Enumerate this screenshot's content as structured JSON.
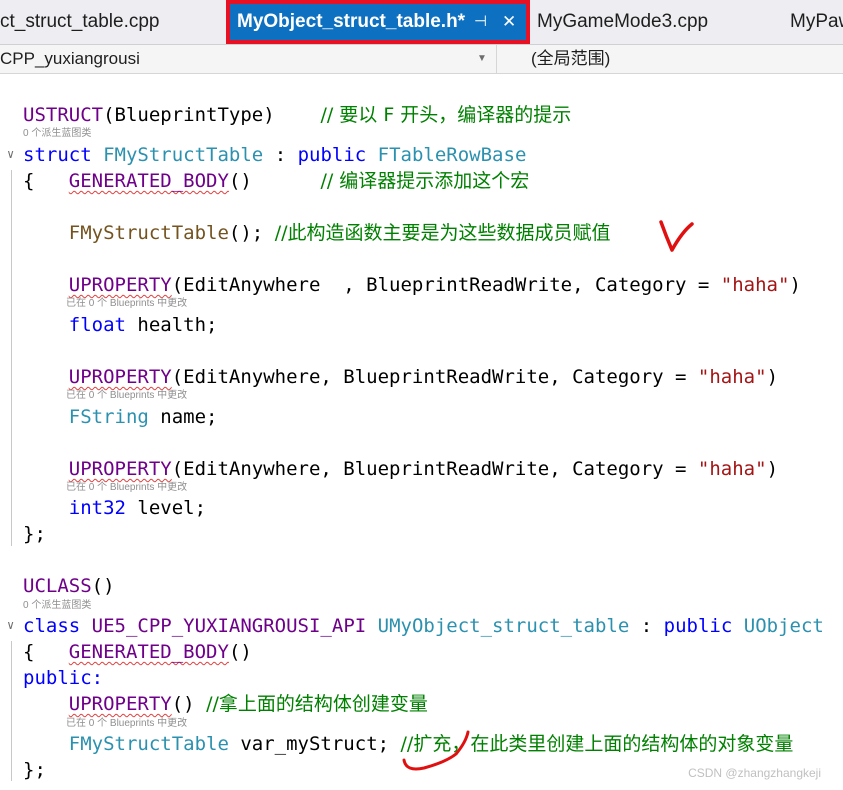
{
  "tabs": [
    {
      "label": "ct_struct_table.cpp"
    },
    {
      "label": "MyObject_struct_table.h*",
      "pin": "⊣",
      "close": "✕"
    },
    {
      "label": "MyGameMode3.cpp"
    },
    {
      "label": "MyPaw"
    }
  ],
  "nav": {
    "project": "CPP_yuxiangrousi",
    "scope": "(全局范围)"
  },
  "code": {
    "l1_macro": "USTRUCT",
    "l1_args": "(BlueprintType)",
    "l1_comment": "// 要以 F 开头，编译器的提示",
    "cl1": "0 个派生蓝图类",
    "l2_kw": "struct",
    "l2_name": "FMyStructTable",
    "l2_colon": " : ",
    "l2_public": "public",
    "l2_base": "FTableRowBase",
    "l3_brace": "{",
    "l3_macro": "GENERATED_BODY",
    "l3_parens": "()",
    "l3_comment": "// 编译器提示添加这个宏",
    "l4_ctor": "FMyStructTable",
    "l4_rest": "();",
    "l4_comment": "//此构造函数主要是为这些数据成员赋值",
    "l5_macro": "UPROPERTY",
    "l5_args": "(EditAnywhere  , BlueprintReadWrite, Category = ",
    "l5_str": "\"haha\"",
    "l5_close": ")",
    "cl5": "已在 0 个 Blueprints 中更改",
    "l6_type": "float",
    "l6_rest": " health;",
    "l7_macro": "UPROPERTY",
    "l7_args": "(EditAnywhere, BlueprintReadWrite, Category = ",
    "l7_str": "\"haha\"",
    "l7_close": ")",
    "cl7": "已在 0 个 Blueprints 中更改",
    "l8_type": "FString",
    "l8_rest": " name;",
    "l9_macro": "UPROPERTY",
    "l9_args": "(EditAnywhere, BlueprintReadWrite, Category = ",
    "l9_str": "\"haha\"",
    "l9_close": ")",
    "cl9": "已在 0 个 Blueprints 中更改",
    "l10_type": "int32",
    "l10_rest": " level;",
    "l11": "};",
    "l12_macro": "UCLASS",
    "l12_parens": "()",
    "cl12": "0 个派生蓝图类",
    "l13_kw": "class",
    "l13_api": "UE5_CPP_YUXIANGROUSI_API",
    "l13_name": "UMyObject_struct_table",
    "l13_colon": " : ",
    "l13_public": "public",
    "l13_base": "UObject",
    "l14_brace": "{",
    "l14_macro": "GENERATED_BODY",
    "l14_parens": "()",
    "l15": "public:",
    "l16_macro": "UPROPERTY",
    "l16_parens": "()",
    "l16_comment": "//拿上面的结构体创建变量",
    "cl16": "已在 0 个 Blueprints 中更改",
    "l17_type": "FMyStructTable",
    "l17_rest": " var_myStruct; ",
    "l17_comment": "//扩充，在此类里创建上面的结构体的对象变量",
    "l18": "};"
  },
  "watermark": "CSDN @zhangzhangkeji",
  "colors": {
    "accent_tab": "#0e70c0",
    "highlight_box": "#e81123",
    "annotation_red": "#e01010",
    "keyword": "#0000ff",
    "type": "#2b91af",
    "macro": "#6f008a",
    "string": "#a31515",
    "comment": "#008000"
  }
}
